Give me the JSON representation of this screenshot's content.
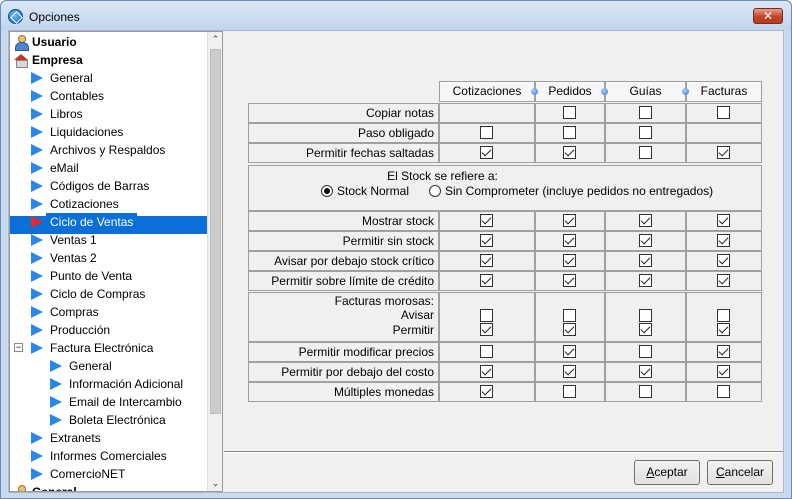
{
  "window": {
    "title": "Opciones",
    "close_glyph": "✕"
  },
  "tree": {
    "items": [
      {
        "label": "Usuario",
        "level": 0,
        "icon": "user-icon",
        "bold": true
      },
      {
        "label": "Empresa",
        "level": 0,
        "icon": "house-icon",
        "bold": true
      },
      {
        "label": "General",
        "level": 1,
        "icon": "arrow-icon"
      },
      {
        "label": "Contables",
        "level": 1,
        "icon": "arrow-icon"
      },
      {
        "label": "Libros",
        "level": 1,
        "icon": "arrow-icon"
      },
      {
        "label": "Liquidaciones",
        "level": 1,
        "icon": "arrow-icon"
      },
      {
        "label": "Archivos y Respaldos",
        "level": 1,
        "icon": "arrow-icon"
      },
      {
        "label": "eMail",
        "level": 1,
        "icon": "arrow-icon"
      },
      {
        "label": "Códigos de Barras",
        "level": 1,
        "icon": "arrow-icon"
      },
      {
        "label": "Cotizaciones",
        "level": 1,
        "icon": "arrow-icon"
      },
      {
        "label": "Ciclo de Ventas",
        "level": 1,
        "icon": "arrow-icon",
        "selected": true
      },
      {
        "label": "Ventas 1",
        "level": 1,
        "icon": "arrow-icon"
      },
      {
        "label": "Ventas 2",
        "level": 1,
        "icon": "arrow-icon"
      },
      {
        "label": "Punto de Venta",
        "level": 1,
        "icon": "arrow-icon"
      },
      {
        "label": "Ciclo de Compras",
        "level": 1,
        "icon": "arrow-icon"
      },
      {
        "label": "Compras",
        "level": 1,
        "icon": "arrow-icon"
      },
      {
        "label": "Producción",
        "level": 1,
        "icon": "arrow-icon"
      },
      {
        "label": "Factura Electrónica",
        "level": 1,
        "icon": "arrow-icon",
        "expander": "−"
      },
      {
        "label": "General",
        "level": 2,
        "icon": "arrow-icon"
      },
      {
        "label": "Información Adicional",
        "level": 2,
        "icon": "arrow-icon"
      },
      {
        "label": "Email de Intercambio",
        "level": 2,
        "icon": "arrow-icon"
      },
      {
        "label": "Boleta Electrónica",
        "level": 2,
        "icon": "arrow-icon"
      },
      {
        "label": "Extranets",
        "level": 1,
        "icon": "arrow-icon"
      },
      {
        "label": "Informes Comerciales",
        "level": 1,
        "icon": "arrow-icon"
      },
      {
        "label": "ComercioNET",
        "level": 1,
        "icon": "arrow-icon"
      },
      {
        "label": "General",
        "level": 0,
        "icon": "user-icon",
        "bold": true
      }
    ],
    "scroll_up": "⌃",
    "scroll_down": "⌄"
  },
  "grid": {
    "columns": [
      "Cotizaciones",
      "Pedidos",
      "Guías",
      "Facturas"
    ],
    "rows": [
      {
        "label": "Copiar notas",
        "checks": [
          null,
          false,
          false,
          false
        ]
      },
      {
        "label": "Paso obligado",
        "checks": [
          false,
          false,
          false,
          null
        ]
      },
      {
        "label": "Permitir fechas saltadas",
        "checks": [
          true,
          true,
          false,
          true
        ]
      }
    ],
    "stock_block": {
      "title": "El Stock se refiere a:",
      "option_normal": "Stock Normal",
      "option_sin": "Sin Comprometer (incluye pedidos no entregados)",
      "selected": "normal"
    },
    "rows2": [
      {
        "label": "Mostrar stock",
        "checks": [
          true,
          true,
          true,
          true
        ]
      },
      {
        "label": "Permitir sin stock",
        "checks": [
          true,
          true,
          true,
          true
        ]
      },
      {
        "label": "Avisar por debajo stock crítico",
        "checks": [
          true,
          true,
          true,
          true
        ]
      },
      {
        "label": "Permitir sobre límite de crédito",
        "checks": [
          true,
          true,
          true,
          true
        ]
      }
    ],
    "morosas": {
      "title": "Facturas morosas:",
      "avisar_label": "Avisar",
      "permitir_label": "Permitir",
      "avisar": [
        false,
        false,
        false,
        false
      ],
      "permitir": [
        true,
        true,
        true,
        true
      ]
    },
    "rows3": [
      {
        "label": "Permitir modificar precios",
        "checks": [
          false,
          true,
          false,
          true
        ]
      },
      {
        "label": "Permitir por debajo del costo",
        "checks": [
          true,
          true,
          true,
          true
        ]
      },
      {
        "label": "Múltiples monedas",
        "checks": [
          true,
          false,
          false,
          false
        ]
      }
    ]
  },
  "buttons": {
    "accept_hotkey": "A",
    "accept_rest": "ceptar",
    "cancel_hotkey": "C",
    "cancel_rest": "ancelar"
  }
}
